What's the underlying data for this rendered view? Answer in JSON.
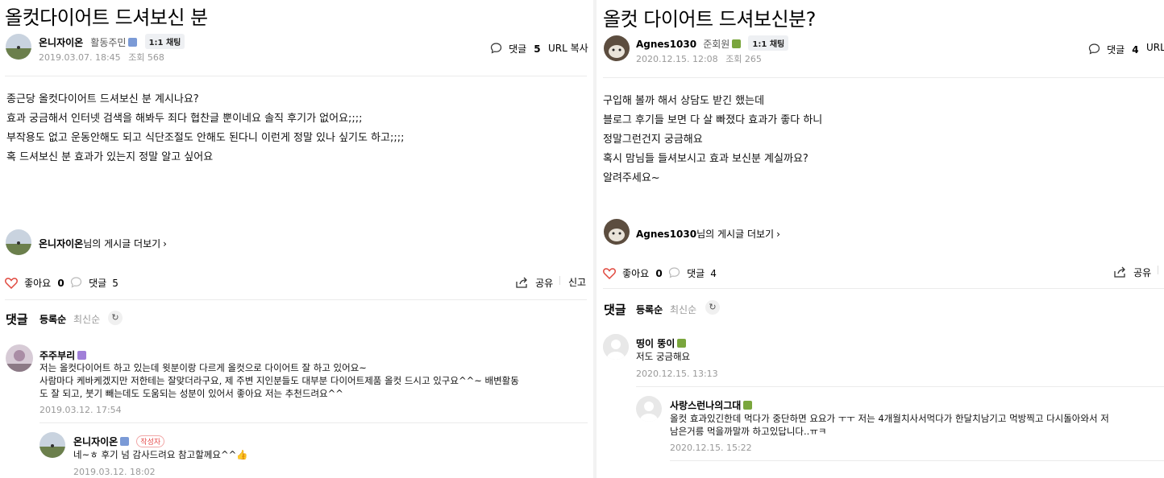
{
  "left": {
    "title": "올컷다이어트 드셔보신 분",
    "author": {
      "name": "온니자이온",
      "level": "활동주민",
      "chat_label": "1:1 채팅"
    },
    "meta": {
      "date": "2019.03.07. 18:45",
      "views": "조회 568"
    },
    "header_actions": {
      "comment_label": "댓글",
      "comment_count": "5",
      "url_copy": "URL 복사"
    },
    "body_lines": [
      "종근당 올컷다이어트 드셔보신 분 계시나요?",
      "효과 궁금해서 인터넷 검색을 해봐두 죄다 협찬글 뿐이네요 솔직 후기가 없어요;;;;",
      "부작용도 없고 운동안해도 되고 식단조절도 안해도 된다니 이런게 정말 있나 싶기도 하고;;;;",
      "혹 드셔보신 분 효과가 있는지 정말 알고 싶어요"
    ],
    "more_posts": {
      "name": "온니자이온",
      "suffix": "님의 게시글 더보기"
    },
    "actions": {
      "like_label": "좋아요",
      "like_count": "0",
      "comment_label": "댓글",
      "comment_count": "5",
      "share": "공유",
      "report": "신고"
    },
    "comments_header": {
      "title": "댓글",
      "sort_registered": "등록순",
      "sort_latest": "최신순"
    },
    "comments": [
      {
        "name": "주주부리",
        "lines": [
          "저는 올컷다이어트 하고 있는데 윗분이랑 다르게 올컷으로 다이어트 잘 하고 있어요~",
          "사람마다 케바케겠지만 저한테는 잘맞더라구요, 제 주변 지인분들도 대부분 다이어트제품 올컷 드시고 있구요^^~ 배변활동",
          "도 잘 되고, 붓기 빼는데도 도움되는 성분이 있어서 좋아요 저는 추천드려요^^"
        ],
        "date": "2019.03.12. 17:54"
      },
      {
        "name": "온니자이온",
        "writer_tag": "작성자",
        "lines": [
          "네~ㅎ 후기 넘 감사드려요 참고할께요^^👍"
        ],
        "date": "2019.03.12. 18:02"
      }
    ]
  },
  "right": {
    "title": "올컷 다이어트 드셔보신분?",
    "author": {
      "name": "Agnes1030",
      "level": "준회원",
      "chat_label": "1:1 채팅"
    },
    "meta": {
      "date": "2020.12.15. 12:08",
      "views": "조회 265"
    },
    "header_actions": {
      "comment_label": "댓글",
      "comment_count": "4",
      "url_copy": "URL"
    },
    "body_lines": [
      "구입해 볼까 해서 상담도 받긴 했는데",
      "블로그 후기들 보면 다 살 빠졌다 효과가 좋다 하니",
      "정말그런건지 궁금해요",
      "혹시 맘님들 들셔보시고 효과 보신분 계실까요?",
      "알려주세요~"
    ],
    "more_posts": {
      "name": "Agnes1030",
      "suffix": "님의 게시글 더보기"
    },
    "actions": {
      "like_label": "좋아요",
      "like_count": "0",
      "comment_label": "댓글",
      "comment_count": "4",
      "share": "공유"
    },
    "comments_header": {
      "title": "댓글",
      "sort_registered": "등록순",
      "sort_latest": "최신순"
    },
    "comments": [
      {
        "name": "띵이 뚱이",
        "lines": [
          "저도 궁금해요"
        ],
        "date": "2020.12.15. 13:13"
      },
      {
        "name": "사랑스런나의그대",
        "lines": [
          "올컷 효과있긴한데 먹다가 중단하면 요요가 ㅜㅜ 저는 4개월치사서먹다가 한달치남기고 먹방찍고 다시돌아와서 저",
          "남은거릉 먹을까말까 하고있답니다..ㅠㅋ"
        ],
        "date": "2020.12.15. 15:22"
      }
    ]
  },
  "colors": {
    "like_heart": "#e0483e",
    "grade_blue": "#7b9ad6",
    "grade_green": "#7aa63d",
    "grade_purple": "#a07fd8",
    "writer_tag": "#e64a4a"
  }
}
